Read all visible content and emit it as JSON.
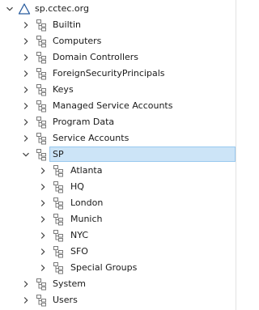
{
  "tree": {
    "root": {
      "label": "sp.cctec.org",
      "expanded": true
    },
    "children": [
      {
        "label": "Builtin",
        "expanded": false
      },
      {
        "label": "Computers",
        "expanded": false
      },
      {
        "label": "Domain Controllers",
        "expanded": false
      },
      {
        "label": "ForeignSecurityPrincipals",
        "expanded": false
      },
      {
        "label": "Keys",
        "expanded": false
      },
      {
        "label": "Managed Service Accounts",
        "expanded": false
      },
      {
        "label": "Program Data",
        "expanded": false
      },
      {
        "label": "Service Accounts",
        "expanded": false
      },
      {
        "label": "SP",
        "expanded": true,
        "selected": true,
        "children": [
          {
            "label": "Atlanta",
            "expanded": false
          },
          {
            "label": "HQ",
            "expanded": false
          },
          {
            "label": "London",
            "expanded": false
          },
          {
            "label": "Munich",
            "expanded": false
          },
          {
            "label": "NYC",
            "expanded": false
          },
          {
            "label": "SFO",
            "expanded": false
          },
          {
            "label": "Special Groups",
            "expanded": false
          }
        ]
      },
      {
        "label": "System",
        "expanded": false
      },
      {
        "label": "Users",
        "expanded": false
      }
    ]
  },
  "icons": {
    "domain": "domain-triangle-icon",
    "container": "org-unit-icon",
    "expanded": "chevron-down-icon",
    "collapsed": "chevron-right-icon"
  },
  "colors": {
    "selection_fill": "#cce4f7",
    "selection_border": "#99c9ef",
    "domain_icon": "#2a5d9f",
    "ou_icon": "#7a7a7a"
  }
}
